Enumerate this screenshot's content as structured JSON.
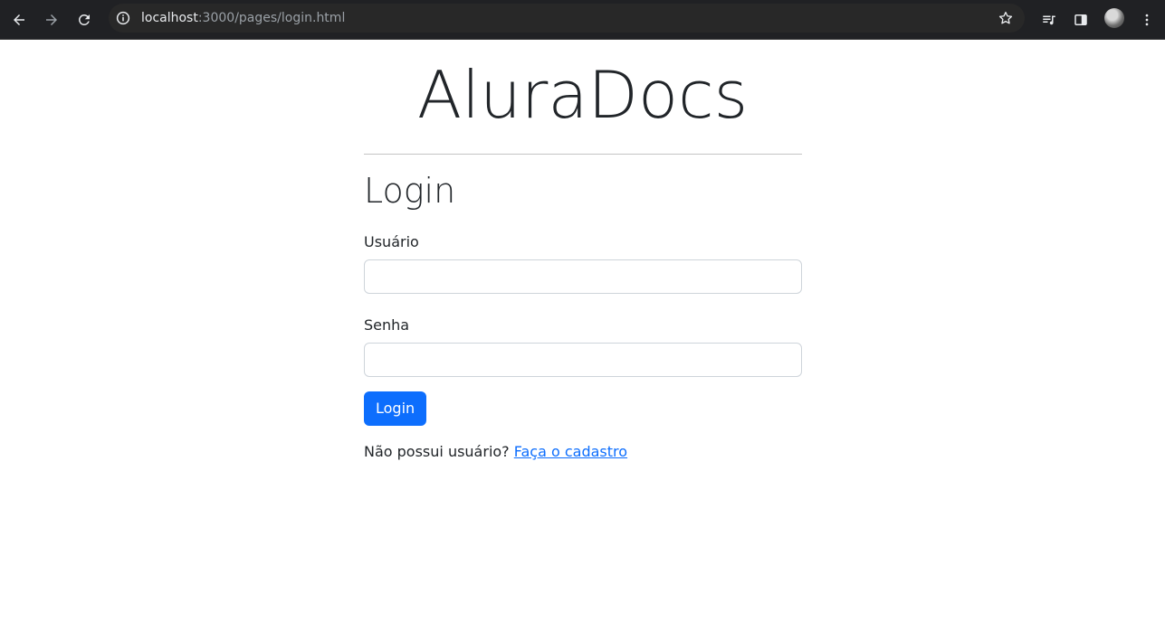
{
  "browser": {
    "url_host": "localhost",
    "url_path": ":3000/pages/login.html",
    "icons": {
      "back": "arrow-left-icon",
      "forward": "arrow-right-icon",
      "reload": "reload-icon",
      "info": "info-icon",
      "bookmark": "star-icon",
      "media": "media-control-icon",
      "side_panel": "side-panel-icon",
      "profile": "avatar",
      "menu": "kebab-menu-icon"
    }
  },
  "page": {
    "brand": "AluraDocs",
    "heading": "Login",
    "username_label": "Usuário",
    "username_value": "",
    "password_label": "Senha",
    "password_value": "",
    "submit_label": "Login",
    "signup_prompt": "Não possui usuário?",
    "signup_link": "Faça o cadastro"
  },
  "colors": {
    "primary": "#0d6efd",
    "text": "#212529",
    "border": "#ced4da",
    "chrome_bg": "#202124"
  }
}
